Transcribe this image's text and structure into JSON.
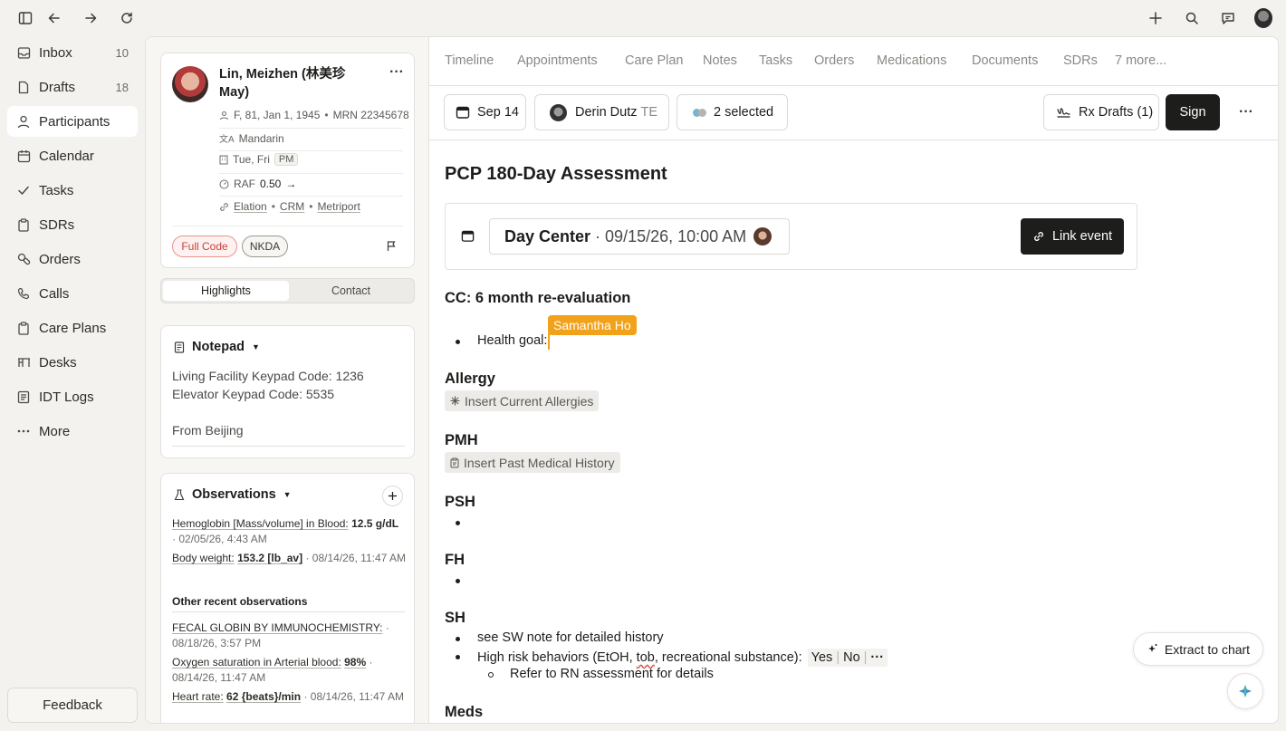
{
  "nav": [
    {
      "label": "Inbox",
      "count": "10",
      "icon": "inbox-icon"
    },
    {
      "label": "Drafts",
      "count": "18",
      "icon": "file-icon"
    },
    {
      "label": "Participants",
      "count": "",
      "icon": "user-icon"
    },
    {
      "label": "Calendar",
      "count": "",
      "icon": "calendar-icon"
    },
    {
      "label": "Tasks",
      "count": "",
      "icon": "check-icon"
    },
    {
      "label": "SDRs",
      "count": "",
      "icon": "clipboard-icon"
    },
    {
      "label": "Orders",
      "count": "",
      "icon": "pills-icon"
    },
    {
      "label": "Calls",
      "count": "",
      "icon": "phone-icon"
    },
    {
      "label": "Care Plans",
      "count": "",
      "icon": "clipboard-icon"
    },
    {
      "label": "Desks",
      "count": "",
      "icon": "desk-icon"
    },
    {
      "label": "IDT Logs",
      "count": "",
      "icon": "list-icon"
    },
    {
      "label": "More",
      "count": "",
      "icon": "ellipsis-icon"
    }
  ],
  "feedback_label": "Feedback",
  "patient": {
    "name_line1": "Lin, Meizhen (林美珍",
    "name_line2": "May)",
    "demographics": "F, 81, Jan 1, 1945",
    "mrn": "MRN 22345678",
    "language": "Mandarin",
    "days": "Tue, Fri",
    "days_badge": "PM",
    "raf_label": "RAF",
    "raf_value": "0.50",
    "raf_arrow": "→",
    "links": [
      "Elation",
      "CRM",
      "Metriport"
    ],
    "tags": [
      "Full Code",
      "NKDA"
    ]
  },
  "segment": {
    "highlights": "Highlights",
    "contact": "Contact"
  },
  "notepad": {
    "title": "Notepad",
    "lines": [
      "Living Facility Keypad Code: 1236",
      "Elevator Keypad Code: 5535",
      "",
      "From Beijing"
    ]
  },
  "observations": {
    "title": "Observations",
    "items": [
      {
        "name": "Hemoglobin [Mass/volume] in Blood:",
        "value": "12.5 g/dL",
        "date": "02/05/26, 4:43 AM"
      },
      {
        "name": "Body weight:",
        "value": "153.2 [lb_av]",
        "date": "08/14/26, 11:47 AM"
      }
    ],
    "other_title": "Other recent observations",
    "other": [
      {
        "name": "FECAL GLOBIN BY IMMUNOCHEMISTRY:",
        "value": "",
        "date": "08/18/26, 3:57 PM"
      },
      {
        "name": "Oxygen saturation in Arterial blood:",
        "value": "98%",
        "date": "08/14/26, 11:47 AM"
      },
      {
        "name": "Heart rate:",
        "value": "62 {beats}/min",
        "date": "08/14/26, 11:47 AM"
      }
    ]
  },
  "tabs": [
    "Timeline",
    "Appointments",
    "Care Plan",
    "Notes",
    "Tasks",
    "Orders",
    "Medications",
    "Documents",
    "SDRs",
    "7 more..."
  ],
  "toolbar": {
    "date": "Sep 14",
    "author": "Derin Dutz",
    "author_suffix": "TE",
    "selected": "2 selected",
    "rx_drafts": "Rx Drafts (1)",
    "sign": "Sign"
  },
  "note": {
    "title": "PCP 180-Day Assessment",
    "event_location": "Day Center",
    "event_time": "· 09/15/26, 10:00 AM",
    "link_event": "Link event",
    "cc": "CC: 6 month re-evaluation",
    "health_goal": "Health goal:",
    "collaborator": "Samantha Ho",
    "allergy_heading": "Allergy",
    "allergy_chip": "Insert Current Allergies",
    "pmh_heading": "PMH",
    "pmh_chip": "Insert Past Medical History",
    "psh_heading": "PSH",
    "fh_heading": "FH",
    "sh_heading": "SH",
    "sh_line1": "see SW note for detailed history",
    "sh_line2_a": "High risk behaviors (EtOH, ",
    "sh_line2_b": "tob",
    "sh_line2_c": ", recreational substance):",
    "sh_yes": "Yes",
    "sh_no": "No",
    "sh_more": "···",
    "sh_sub": "Refer to RN assessment for details",
    "meds_heading": "Meds"
  },
  "extract_to_chart": "Extract to chart",
  "colors": {
    "accent_orange": "#f2a11a",
    "sign_bg": "#1d1d1b",
    "full_code_red": "#d9534f"
  }
}
